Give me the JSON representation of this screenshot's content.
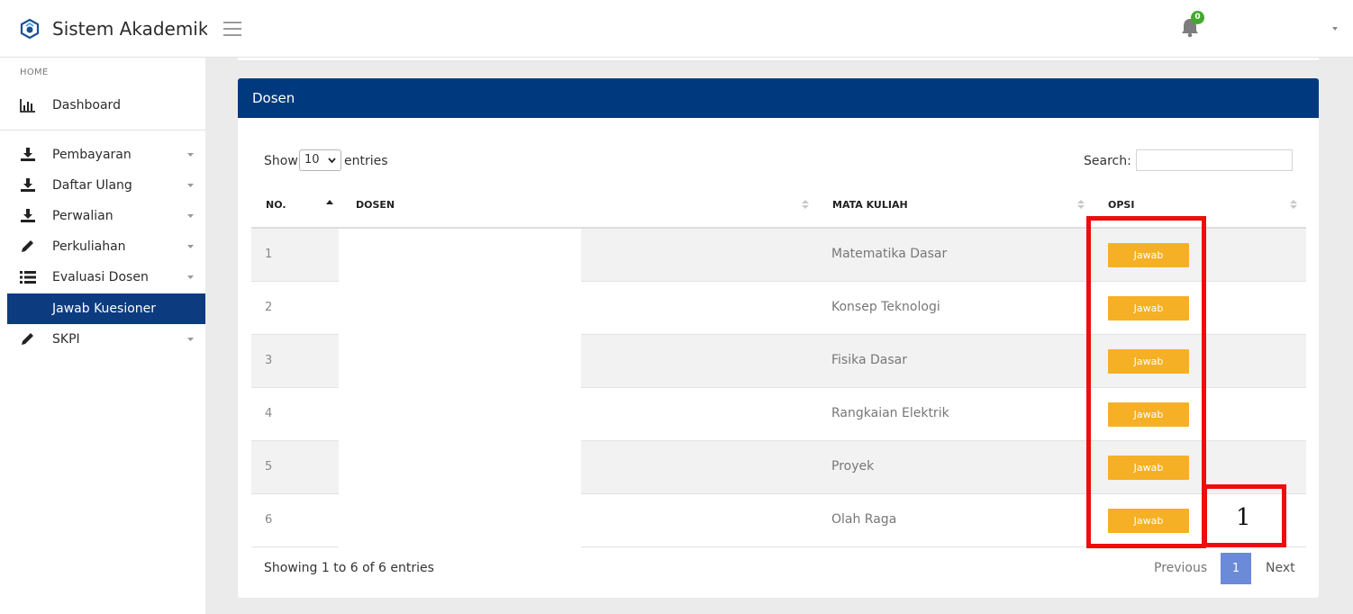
{
  "app": {
    "title": "Sistem Akademik"
  },
  "header": {
    "notification_count": "0"
  },
  "sidebar": {
    "section_label": "HOME",
    "items": [
      {
        "label": "Dashboard",
        "icon": "bar-chart-icon"
      },
      {
        "label": "Pembayaran",
        "icon": "download-icon"
      },
      {
        "label": "Daftar Ulang",
        "icon": "download-icon"
      },
      {
        "label": "Perwalian",
        "icon": "download-icon"
      },
      {
        "label": "Perkuliahan",
        "icon": "pencil-icon"
      },
      {
        "label": "Evaluasi Dosen",
        "icon": "list-icon"
      },
      {
        "label": "Jawab Kuesioner",
        "icon": ""
      },
      {
        "label": "SKPI",
        "icon": "pencil-icon"
      }
    ]
  },
  "card": {
    "title": "Dosen",
    "show_label": "Show",
    "entries_value": "10",
    "entries_label": "entries",
    "search_label": "Search:",
    "search_value": ""
  },
  "table": {
    "columns": [
      "NO.",
      "DOSEN",
      "MATA KULIAH",
      "OPSI"
    ],
    "rows": [
      {
        "no": "1",
        "dosen": "",
        "mata_kuliah": "Matematika Dasar",
        "action": "Jawab"
      },
      {
        "no": "2",
        "dosen": "",
        "mata_kuliah": "Konsep Teknologi",
        "action": "Jawab"
      },
      {
        "no": "3",
        "dosen": "",
        "mata_kuliah": "Fisika Dasar",
        "action": "Jawab"
      },
      {
        "no": "4",
        "dosen": "",
        "mata_kuliah": "Rangkaian Elektrik",
        "action": "Jawab"
      },
      {
        "no": "5",
        "dosen": "",
        "mata_kuliah": "Proyek",
        "action": "Jawab"
      },
      {
        "no": "6",
        "dosen": "",
        "mata_kuliah": "Olah Raga",
        "action": "Jawab"
      }
    ]
  },
  "footer": {
    "info": "Showing 1 to 6 of 6 entries",
    "previous": "Previous",
    "page": "1",
    "next": "Next"
  },
  "annotation": {
    "label": "1"
  },
  "colors": {
    "header_bar": "#00397d",
    "sidebar_active": "#0c3b80",
    "button": "#f5b026",
    "badge": "#43a92d",
    "annotation": "#ee0d0d",
    "page_active": "#6b8ad8"
  }
}
